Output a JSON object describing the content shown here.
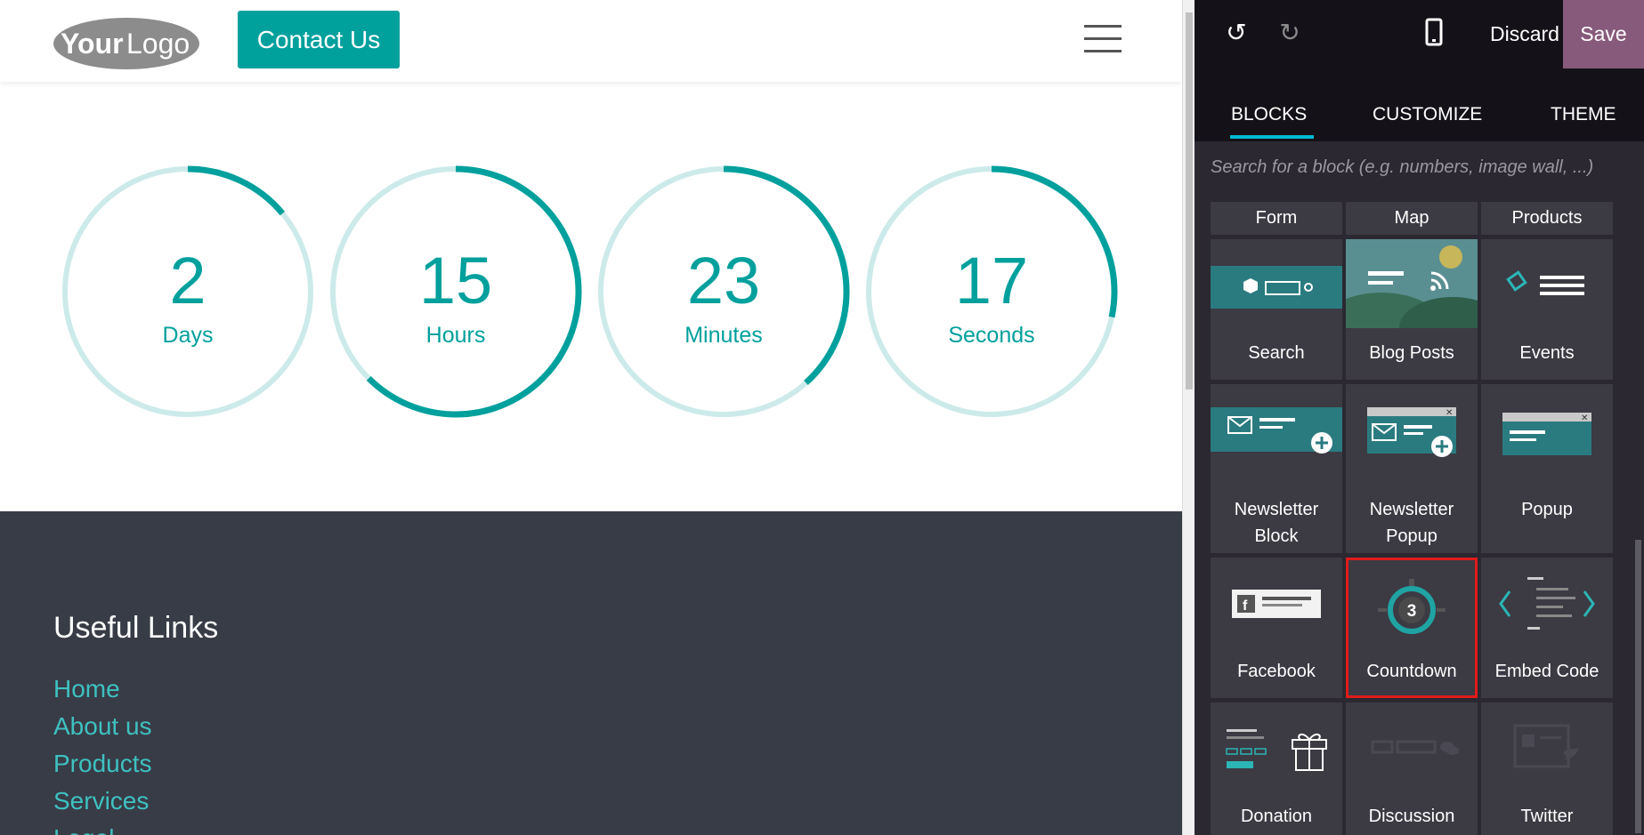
{
  "site": {
    "logo_text_bold": "Your",
    "logo_text_light": "Logo",
    "contact_button": "Contact Us",
    "countdown": [
      {
        "value": "2",
        "label": "Days",
        "fraction": 0.14
      },
      {
        "value": "15",
        "label": "Hours",
        "fraction": 0.625
      },
      {
        "value": "23",
        "label": "Minutes",
        "fraction": 0.383
      },
      {
        "value": "17",
        "label": "Seconds",
        "fraction": 0.283
      }
    ],
    "footer": {
      "title": "Useful Links",
      "links": [
        "Home",
        "About us",
        "Products",
        "Services",
        "Legal"
      ]
    }
  },
  "editor": {
    "toolbar": {
      "undo_icon": "undo-icon",
      "redo_icon": "redo-icon",
      "mobile_icon": "mobile-icon",
      "discard": "Discard",
      "save": "Save"
    },
    "tabs": [
      "BLOCKS",
      "CUSTOMIZE",
      "THEME"
    ],
    "active_tab": "BLOCKS",
    "search_placeholder": "Search for a block (e.g. numbers, image wall, ...)",
    "blocks": {
      "row0": [
        "Form",
        "Map",
        "Products"
      ],
      "row1": [
        "Search",
        "Blog Posts",
        "Events"
      ],
      "row2": [
        "Newsletter Block",
        "Newsletter Popup",
        "Popup"
      ],
      "row3": [
        "Facebook",
        "Countdown",
        "Embed Code"
      ],
      "row4": [
        "Donation",
        "Discussion",
        "Twitter"
      ]
    },
    "selected_block": "Countdown",
    "countdown_thumb_digit": "3"
  },
  "colors": {
    "accent": "#00a09d",
    "save": "#875a7b",
    "panel": "#2b2831",
    "footer": "#383c46",
    "link": "#3ec1c1",
    "selection": "#e11b1b"
  }
}
